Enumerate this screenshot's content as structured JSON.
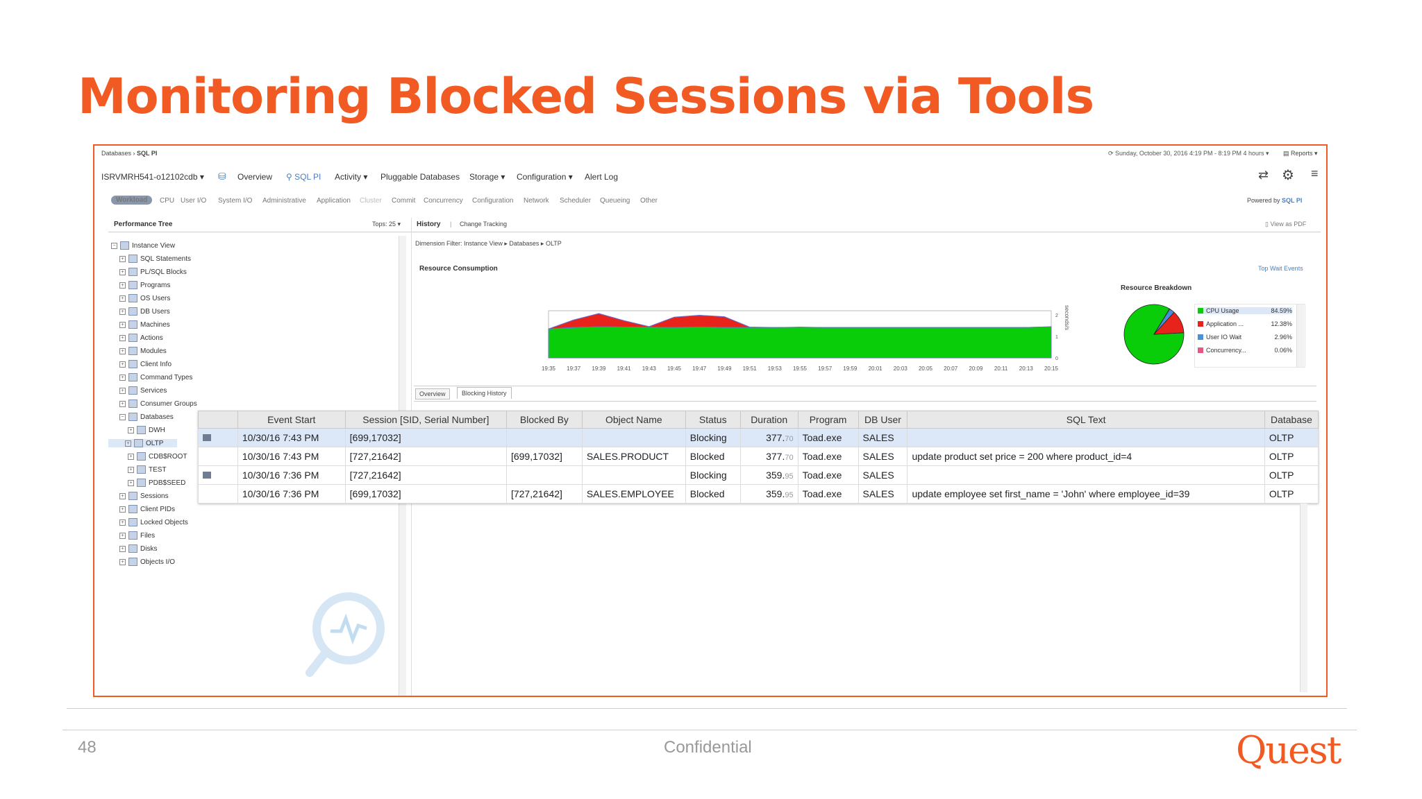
{
  "slide": {
    "title": "Monitoring Blocked Sessions via Tools",
    "page_number": "48",
    "footer": "Confidential",
    "logo_text": "Quest"
  },
  "app": {
    "breadcrumb": [
      "Databases",
      "SQL PI"
    ],
    "timerange": "Sunday, October 30, 2016 4:19 PM - 8:19 PM 4 hours",
    "reports": "Reports",
    "instance": "ISRVMRH541-o12102cdb",
    "nav": [
      "Overview",
      "SQL PI",
      "Activity",
      "Pluggable Databases",
      "Storage",
      "Configuration",
      "Alert Log"
    ],
    "categories": [
      "Workload",
      "CPU",
      "User I/O",
      "System I/O",
      "Administrative",
      "Application",
      "Cluster",
      "Commit",
      "Concurrency",
      "Configuration",
      "Network",
      "Scheduler",
      "Queueing",
      "Other"
    ],
    "powered_by": "Powered by",
    "powered_brand": "SQL PI"
  },
  "tree": {
    "title": "Performance Tree",
    "tops": "Tops: 25",
    "items": [
      {
        "label": "Instance View",
        "level": 0
      },
      {
        "label": "SQL Statements",
        "level": 1
      },
      {
        "label": "PL/SQL Blocks",
        "level": 1
      },
      {
        "label": "Programs",
        "level": 1
      },
      {
        "label": "OS Users",
        "level": 1
      },
      {
        "label": "DB Users",
        "level": 1
      },
      {
        "label": "Machines",
        "level": 1
      },
      {
        "label": "Actions",
        "level": 1
      },
      {
        "label": "Modules",
        "level": 1
      },
      {
        "label": "Client Info",
        "level": 1
      },
      {
        "label": "Command Types",
        "level": 1
      },
      {
        "label": "Services",
        "level": 1
      },
      {
        "label": "Consumer Groups",
        "level": 1
      },
      {
        "label": "Databases",
        "level": 1
      },
      {
        "label": "DWH",
        "level": 2
      },
      {
        "label": "OLTP",
        "level": 2
      },
      {
        "label": "CDB$ROOT",
        "level": 2
      },
      {
        "label": "TEST",
        "level": 2
      },
      {
        "label": "PDB$SEED",
        "level": 2
      },
      {
        "label": "Sessions",
        "level": 1
      },
      {
        "label": "Client PIDs",
        "level": 1
      },
      {
        "label": "Locked Objects",
        "level": 1
      },
      {
        "label": "Files",
        "level": 1
      },
      {
        "label": "Disks",
        "level": 1
      },
      {
        "label": "Objects I/O",
        "level": 1
      }
    ]
  },
  "main": {
    "tabs": [
      "History",
      "Change Tracking"
    ],
    "view_pdf": "View as PDF",
    "filter": "Dimension Filter: Instance View ▸ Databases ▸ OLTP",
    "resource_title": "Resource Consumption",
    "top_wait": "Top Wait Events",
    "y_axis_label": "seconds/s",
    "subtabs": [
      "Overview",
      "Blocking History"
    ]
  },
  "chart_data": [
    {
      "type": "area",
      "title": "Resource Consumption",
      "x": [
        "19:35",
        "19:37",
        "19:39",
        "19:41",
        "19:43",
        "19:45",
        "19:47",
        "19:49",
        "19:51",
        "19:53",
        "19:55",
        "19:57",
        "19:59",
        "20:01",
        "20:03",
        "20:05",
        "20:07",
        "20:09",
        "20:11",
        "20:13",
        "20:15"
      ],
      "ylabel": "seconds/s",
      "yticks": [
        0,
        1,
        2
      ],
      "series": [
        {
          "name": "CPU Usage",
          "color": "#0acd0a",
          "values": [
            1.35,
            1.42,
            1.45,
            1.44,
            1.43,
            1.42,
            1.44,
            1.42,
            1.42,
            1.42,
            1.43,
            1.42,
            1.42,
            1.42,
            1.42,
            1.42,
            1.42,
            1.42,
            1.42,
            1.42,
            1.45
          ]
        },
        {
          "name": "Application",
          "color": "#e8231c",
          "values": [
            0,
            0.35,
            0.62,
            0.3,
            0.03,
            0.48,
            0.55,
            0.5,
            0.02,
            0,
            0,
            0,
            0,
            0,
            0,
            0,
            0,
            0,
            0,
            0,
            0
          ]
        }
      ]
    },
    {
      "type": "pie",
      "title": "Resource Breakdown",
      "labels": [
        "CPU Usage",
        "Application ...",
        "User IO Wait",
        "Concurrency..."
      ],
      "values": [
        84.59,
        12.38,
        2.96,
        0.06
      ],
      "display_values": [
        "84.59%",
        "12.38%",
        "2.96%",
        "0.06%"
      ],
      "colors": [
        "#0acd0a",
        "#e8231c",
        "#4a90d9",
        "#e9567d"
      ]
    }
  ],
  "grid": {
    "columns": [
      "",
      "Event Start",
      "Session [SID, Serial Number]",
      "Blocked By",
      "Object Name",
      "Status",
      "Duration",
      "Program",
      "DB User",
      "SQL Text",
      "Database"
    ],
    "rows": [
      {
        "marker": true,
        "event_start": "10/30/16 7:43 PM",
        "session": "[699,17032]",
        "blocked_by": "",
        "object": "",
        "status": "Blocking",
        "duration_int": "377.",
        "duration_dec": "70",
        "program": "Toad.exe",
        "db_user": "SALES",
        "sql": "",
        "database": "OLTP"
      },
      {
        "marker": false,
        "event_start": "10/30/16 7:43 PM",
        "session": "[727,21642]",
        "blocked_by": "[699,17032]",
        "object": "SALES.PRODUCT",
        "status": "Blocked",
        "duration_int": "377.",
        "duration_dec": "70",
        "program": "Toad.exe",
        "db_user": "SALES",
        "sql": "update product set price = 200 where product_id=4",
        "database": "OLTP"
      },
      {
        "marker": true,
        "event_start": "10/30/16 7:36 PM",
        "session": "[727,21642]",
        "blocked_by": "",
        "object": "",
        "status": "Blocking",
        "duration_int": "359.",
        "duration_dec": "95",
        "program": "Toad.exe",
        "db_user": "SALES",
        "sql": "",
        "database": "OLTP"
      },
      {
        "marker": false,
        "event_start": "10/30/16 7:36 PM",
        "session": "[699,17032]",
        "blocked_by": "[727,21642]",
        "object": "SALES.EMPLOYEE",
        "status": "Blocked",
        "duration_int": "359.",
        "duration_dec": "95",
        "program": "Toad.exe",
        "db_user": "SALES",
        "sql": "update employee set first_name = 'John' where employee_id=39",
        "database": "OLTP"
      }
    ]
  }
}
